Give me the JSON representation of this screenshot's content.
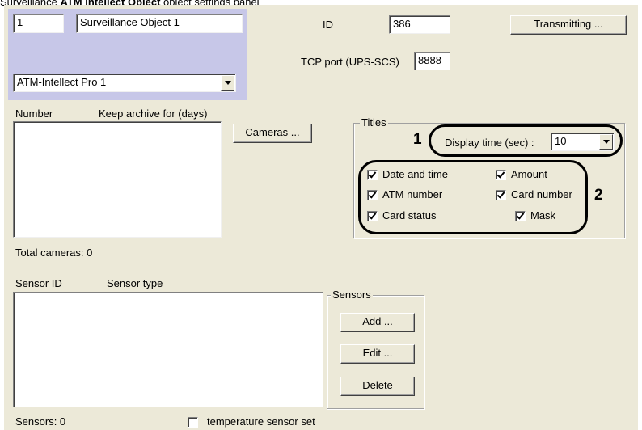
{
  "caption": {
    "prefix": "Surveillance ",
    "bold": "ATM Intellect Object",
    "suffix": " object settings panel"
  },
  "object": {
    "number": "1",
    "name": "Surveillance Object 1",
    "parent": "ATM-Intellect Pro 1"
  },
  "id_field": {
    "label": "ID",
    "value": "386"
  },
  "tcp_field": {
    "label": "TCP port (UPS-SCS)",
    "value": "8888"
  },
  "buttons": {
    "transmitting": "Transmitting ...",
    "cameras": "Cameras ...",
    "add": "Add ...",
    "edit": "Edit ...",
    "delete": "Delete"
  },
  "cameras_list": {
    "col_number": "Number",
    "col_archive": "Keep archive for (days)",
    "total": "Total cameras: 0"
  },
  "titles": {
    "legend": "Titles",
    "display_time_label": "Display time (sec) :",
    "display_time_value": "10",
    "date_time": "Date and time",
    "amount": "Amount",
    "atm_number": "ATM number",
    "card_number": "Card number",
    "card_status": "Card status",
    "mask": "Mask"
  },
  "markers": {
    "m1": "1",
    "m2": "2"
  },
  "sensors_list": {
    "col_id": "Sensor ID",
    "col_type": "Sensor type",
    "total": "Sensors: 0"
  },
  "sensors_group": {
    "legend": "Sensors"
  },
  "temperature": {
    "label": "temperature sensor set",
    "checked": false
  }
}
